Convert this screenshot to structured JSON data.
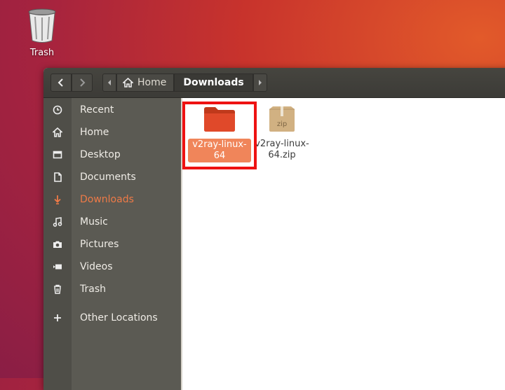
{
  "desktop": {
    "trash_label": "Trash"
  },
  "headerbar": {
    "back_icon": "chevron-left-icon",
    "forward_icon": "chevron-right-icon",
    "path": [
      {
        "label": "Home",
        "icon": "home-icon"
      },
      {
        "label": "Downloads"
      }
    ]
  },
  "sidebar": {
    "items": [
      {
        "label": "Recent",
        "icon": "clock-icon"
      },
      {
        "label": "Home",
        "icon": "home-icon"
      },
      {
        "label": "Desktop",
        "icon": "desktop-icon"
      },
      {
        "label": "Documents",
        "icon": "document-icon"
      },
      {
        "label": "Downloads",
        "icon": "download-icon",
        "active": true
      },
      {
        "label": "Music",
        "icon": "music-icon"
      },
      {
        "label": "Pictures",
        "icon": "camera-icon"
      },
      {
        "label": "Videos",
        "icon": "video-icon"
      },
      {
        "label": "Trash",
        "icon": "trash-icon"
      },
      {
        "label": "Other Locations",
        "icon": "plus-icon"
      }
    ]
  },
  "files": [
    {
      "name": "v2ray-linux-64",
      "type": "folder",
      "selected": true
    },
    {
      "name": "v2ray-linux-64.zip",
      "type": "zip",
      "badge": "zip"
    }
  ],
  "colors": {
    "accent": "#ee7a47",
    "selection": "#f0855a",
    "highlight": "#ee1212"
  }
}
